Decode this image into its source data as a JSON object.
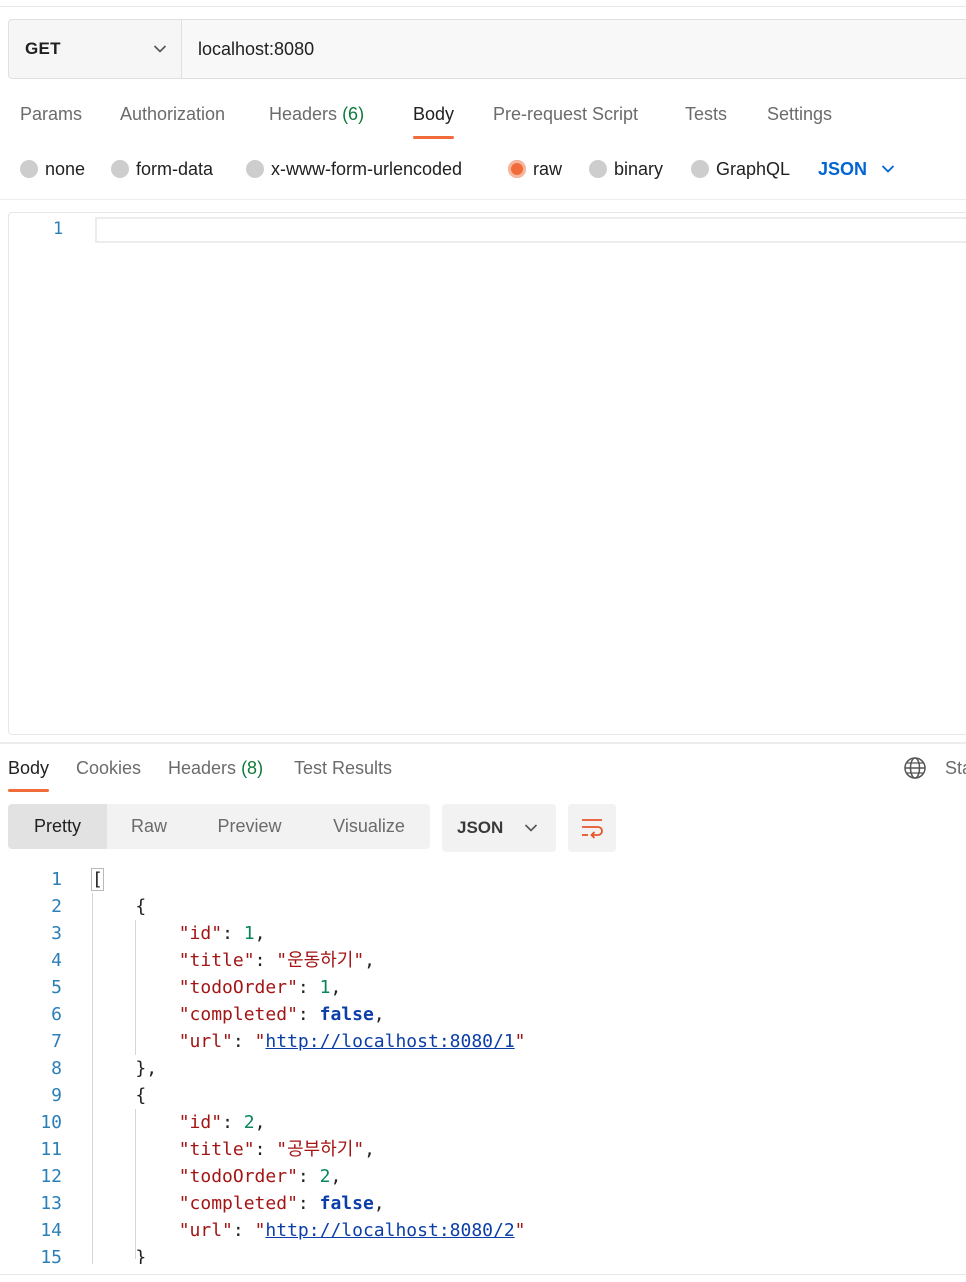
{
  "request": {
    "method": "GET",
    "url": "localhost:8080",
    "tabs": [
      {
        "label": "Params",
        "count": ""
      },
      {
        "label": "Authorization",
        "count": ""
      },
      {
        "label": "Headers",
        "count": "(6)"
      },
      {
        "label": "Body",
        "count": ""
      },
      {
        "label": "Pre-request Script",
        "count": ""
      },
      {
        "label": "Tests",
        "count": ""
      },
      {
        "label": "Settings",
        "count": ""
      }
    ],
    "active_tab": "Body",
    "body_types": [
      "none",
      "form-data",
      "x-www-form-urlencoded",
      "raw",
      "binary",
      "GraphQL"
    ],
    "selected_body_type": "raw",
    "body_format": "JSON",
    "editor_line_numbers": [
      "1"
    ]
  },
  "response": {
    "tabs": [
      {
        "label": "Body",
        "count": ""
      },
      {
        "label": "Cookies",
        "count": ""
      },
      {
        "label": "Headers",
        "count": "(8)"
      },
      {
        "label": "Test Results",
        "count": ""
      }
    ],
    "status_label_partial": "Sta",
    "view_modes": [
      "Pretty",
      "Raw",
      "Preview",
      "Visualize"
    ],
    "active_view": "Pretty",
    "format": "JSON",
    "line_numbers": [
      "1",
      "2",
      "3",
      "4",
      "5",
      "6",
      "7",
      "8",
      "9",
      "10",
      "11",
      "12",
      "13",
      "14",
      "15"
    ],
    "items": [
      {
        "id": "1",
        "title": "\"운동하기\"",
        "todoOrder": "1",
        "completed": "false",
        "url": "http://localhost:8080/1"
      },
      {
        "id": "2",
        "title": "\"공부하기\"",
        "todoOrder": "2",
        "completed": "false",
        "url": "http://localhost:8080/2"
      }
    ],
    "keys": {
      "id": "\"id\"",
      "title": "\"title\"",
      "todoOrder": "\"todoOrder\"",
      "completed": "\"completed\"",
      "url": "\"url\""
    }
  },
  "colors": {
    "accent": "#f26b3a",
    "link": "#0265d2",
    "count": "#0f7b3b"
  }
}
